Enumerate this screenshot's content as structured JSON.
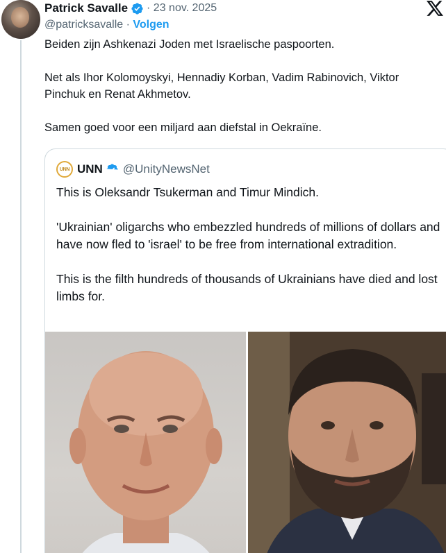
{
  "tweet": {
    "author_name": "Patrick Savalle",
    "date": "· 23 nov. 2025",
    "handle": "@patricksavalle",
    "separator": " · ",
    "follow_label": "Volgen",
    "paragraphs": [
      "Beiden zijn Ashkenazi Joden met Israelische paspoorten.",
      "Net als Ihor Kolomoyskyi, Hennadiy Korban, Vadim Rabinovich, Viktor Pinchuk en Renat Akhmetov.",
      "Samen goed voor een miljard aan diefstal in Oekraïne."
    ]
  },
  "quote": {
    "logo_text": "UNN",
    "author_name": "UNN",
    "handle": "@UnityNewsNet",
    "paragraphs": [
      "This is Oleksandr Tsukerman and Timur Mindich.",
      "'Ukrainian' oligarchs who embezzled hundreds of millions of dollars and have now fled to 'israel' to be free from international extradition.",
      "This is the filth hundreds of thousands of Ukrainians have died and lost limbs for."
    ]
  },
  "icons": {
    "verified": "verified-badge-icon",
    "platform": "x-logo-icon"
  },
  "colors": {
    "accent": "#1d9bf0",
    "text": "#0f1419",
    "secondary": "#536471",
    "border": "#cfd9de"
  }
}
